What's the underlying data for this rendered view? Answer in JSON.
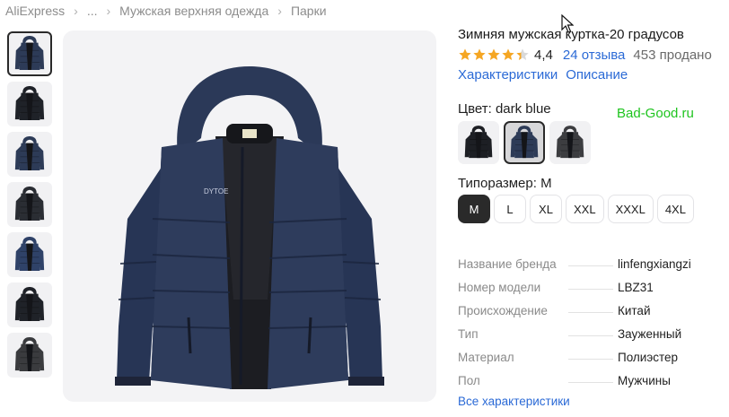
{
  "breadcrumb": {
    "items": [
      "AliExpress",
      "...",
      "Мужская верхняя одежда",
      "Парки"
    ]
  },
  "product": {
    "title": "Зимняя мужская куртка-20 градусов",
    "rating": "4,4",
    "rating_stars": 4.4,
    "reviews": "24 отзыва",
    "sold": "453 продано",
    "links": [
      "Характеристики",
      "Описание"
    ]
  },
  "color": {
    "label": "Цвет: dark blue",
    "watermark": "Bad-Good.ru",
    "options": [
      {
        "name": "black",
        "jacket_color": "#1d1f24",
        "selected": false
      },
      {
        "name": "dark blue",
        "jacket_color": "#2d3b57",
        "selected": true
      },
      {
        "name": "gray",
        "jacket_color": "#3c3d40",
        "selected": false
      }
    ]
  },
  "size": {
    "label": "Типоразмер: M",
    "options": [
      "M",
      "L",
      "XL",
      "XXL",
      "XXXL",
      "4XL"
    ],
    "selected": "M"
  },
  "specs": {
    "rows": [
      {
        "key": "Название бренда",
        "value": "linfengxiangzi"
      },
      {
        "key": "Номер модели",
        "value": "LBZ31"
      },
      {
        "key": "Происхождение",
        "value": "Китай"
      },
      {
        "key": "Тип",
        "value": "Зауженный"
      },
      {
        "key": "Материал",
        "value": "Полиэстер"
      },
      {
        "key": "Пол",
        "value": "Мужчины"
      }
    ],
    "all_link": "Все характеристики"
  },
  "gallery": {
    "main_label": "DYTOE",
    "thumbnails": [
      {
        "color": "#2d3b57",
        "selected": true
      },
      {
        "color": "#1f2228",
        "selected": false
      },
      {
        "color": "#2d3b57",
        "selected": false
      },
      {
        "color": "#2a2d33",
        "selected": false
      },
      {
        "color": "#2f4268",
        "selected": false
      },
      {
        "color": "#1f2228",
        "selected": false
      },
      {
        "color": "#3a3b3e",
        "selected": false
      }
    ]
  },
  "colors": {
    "accent_link": "#2b6ad6",
    "star": "#f5a623",
    "watermark": "#1ec41e",
    "jacket_main": "#2d3b57"
  }
}
